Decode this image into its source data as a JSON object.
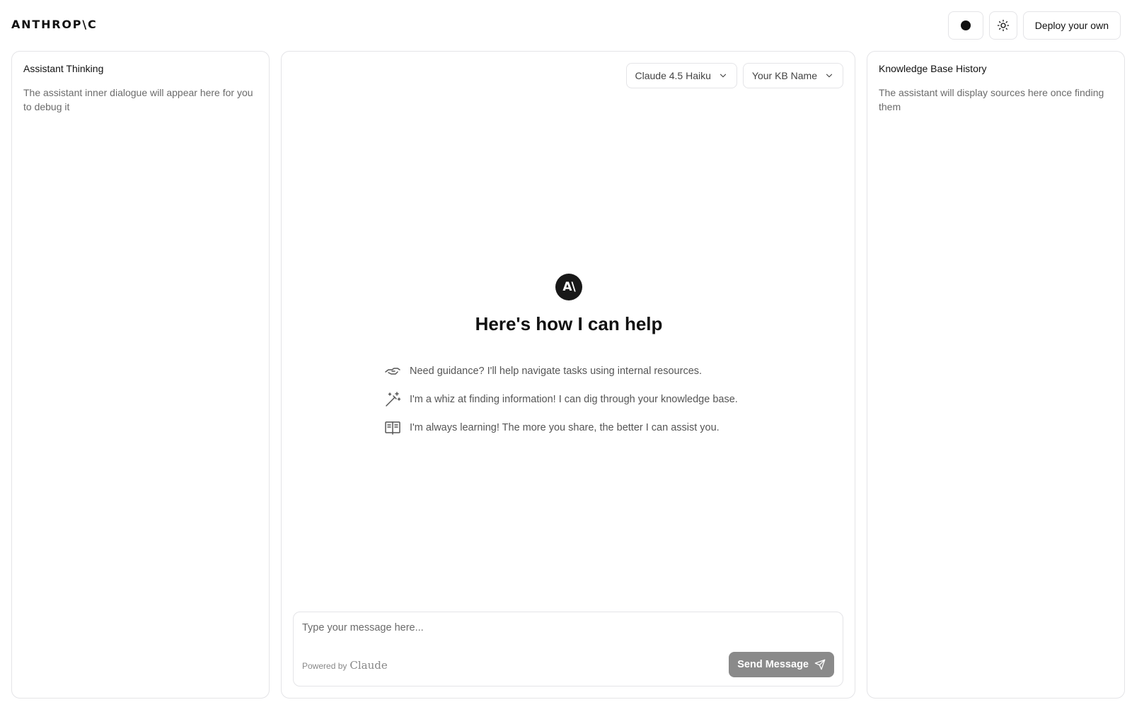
{
  "header": {
    "logo": "ANTHROP\\C",
    "deploy_label": "Deploy your own",
    "dot_icon": "record-dot-icon",
    "theme_icon": "sun-icon"
  },
  "left_panel": {
    "title": "Assistant Thinking",
    "description": "The assistant inner dialogue will appear here for you to debug it"
  },
  "right_panel": {
    "title": "Knowledge Base History",
    "description": "The assistant will display sources here once finding them"
  },
  "center": {
    "model_select": "Claude 4.5 Haiku",
    "kb_select": "Your KB Name",
    "avatar_text": "A\\",
    "headline": "Here's how I can help",
    "features": [
      {
        "icon": "handshake-icon",
        "text": "Need guidance? I'll help navigate tasks using internal resources."
      },
      {
        "icon": "magic-wand-icon",
        "text": "I'm a whiz at finding information! I can dig through your knowledge base."
      },
      {
        "icon": "open-book-icon",
        "text": "I'm always learning! The more you share, the better I can assist you."
      }
    ],
    "composer": {
      "placeholder": "Type your message here...",
      "powered_by": "Powered by",
      "powered_brand": "Claude",
      "send_label": "Send Message"
    }
  },
  "colors": {
    "border": "#e4e4e7",
    "send_button": "#8a8a8a",
    "muted_text": "#6b6b6b"
  }
}
